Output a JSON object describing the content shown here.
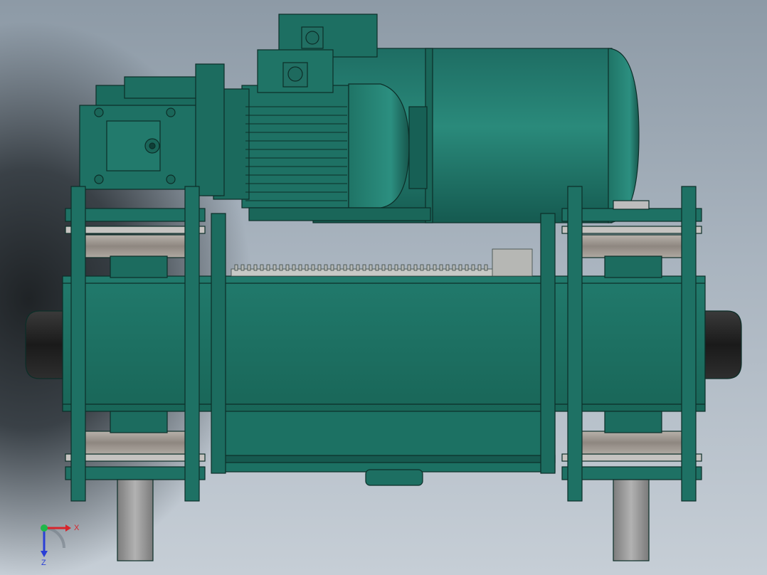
{
  "viewport": {
    "background_top": "#8d9aa6",
    "background_bottom": "#c6ced6"
  },
  "model": {
    "body_color": "#1f7a6a",
    "body_shade": "#135a4e",
    "edge_color": "#0c2e28",
    "steel_color": "#9a9a9a",
    "rubber_color": "#2a2a2a"
  },
  "axis_triad": {
    "x_label": "X",
    "z_label": "Z",
    "x_color": "#d8242b",
    "z_color": "#2a3fd6",
    "origin_color": "#1fb84a"
  }
}
